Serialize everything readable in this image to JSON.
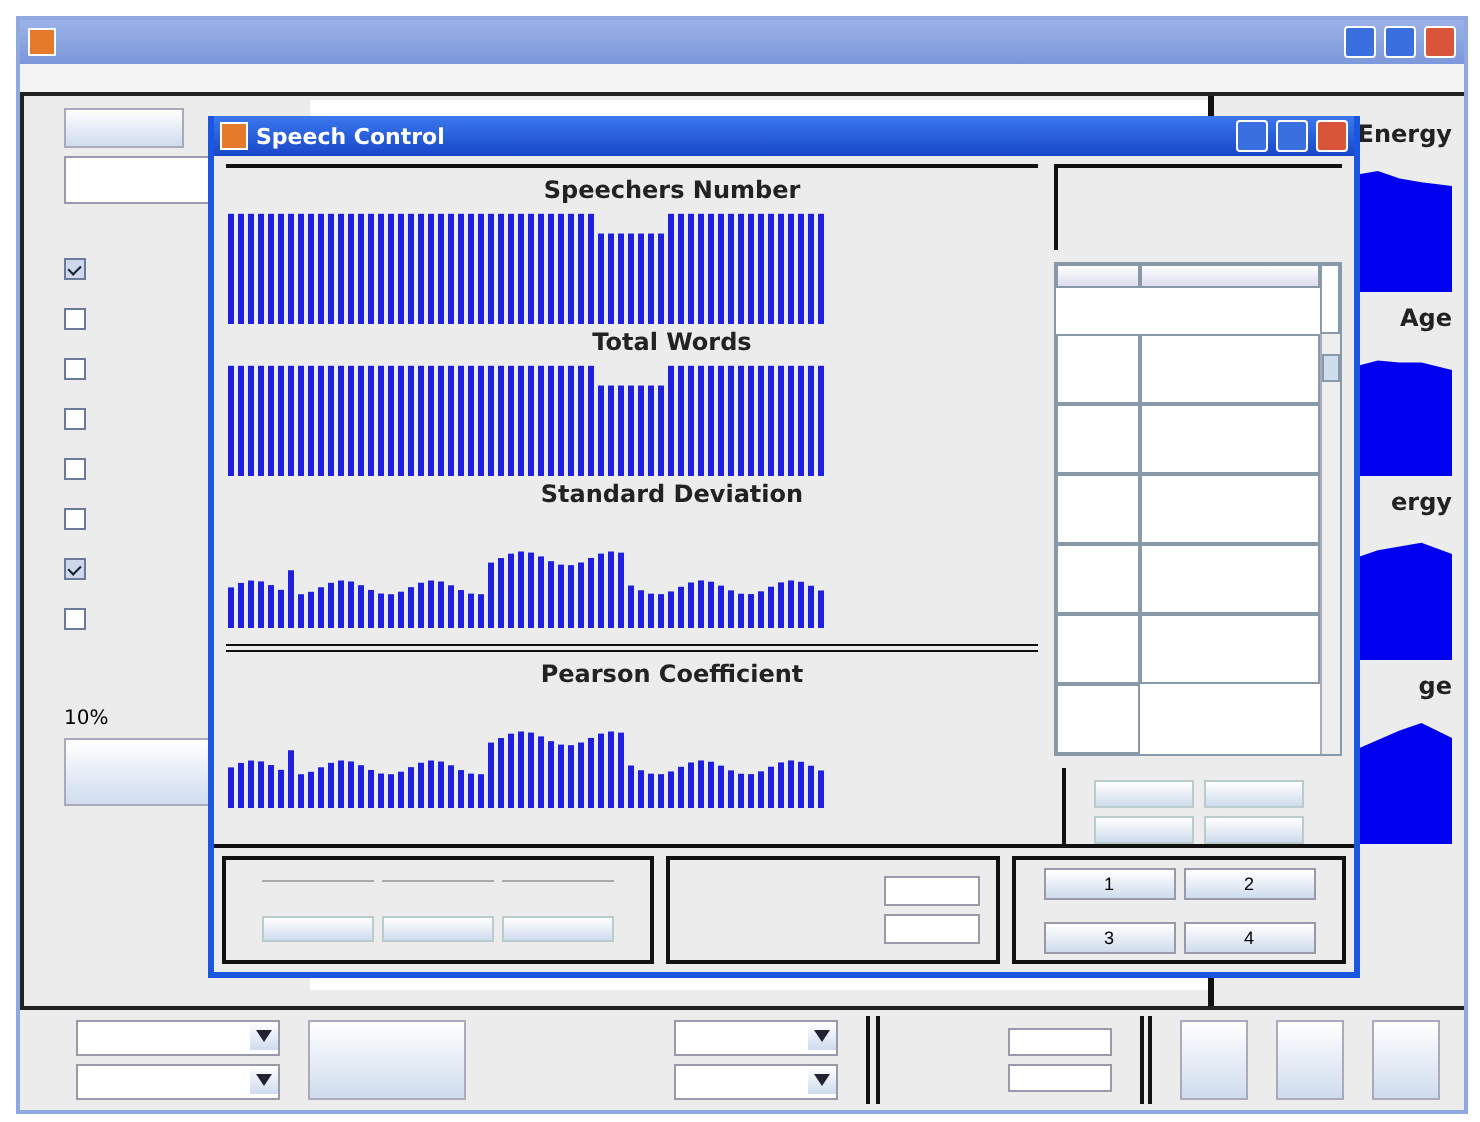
{
  "main": {
    "checkboxes": [
      {
        "checked": true
      },
      {
        "checked": false
      },
      {
        "checked": false
      },
      {
        "checked": false
      },
      {
        "checked": false
      },
      {
        "checked": false
      },
      {
        "checked": true
      },
      {
        "checked": false
      }
    ],
    "progress_label": "10%",
    "right_panels": [
      {
        "title": "Energy"
      },
      {
        "title": "Age"
      },
      {
        "title": "ergy"
      },
      {
        "title": "ge"
      }
    ]
  },
  "dialog": {
    "title": "Speech Control",
    "charts": [
      {
        "title": "Speechers Number",
        "kind": "full"
      },
      {
        "title": "Total Words",
        "kind": "full"
      },
      {
        "title": "Standard Deviation",
        "kind": "low"
      },
      {
        "title": "Pearson Coefficient",
        "kind": "low"
      }
    ],
    "buttons": [
      "1",
      "2",
      "3",
      "4"
    ]
  }
}
